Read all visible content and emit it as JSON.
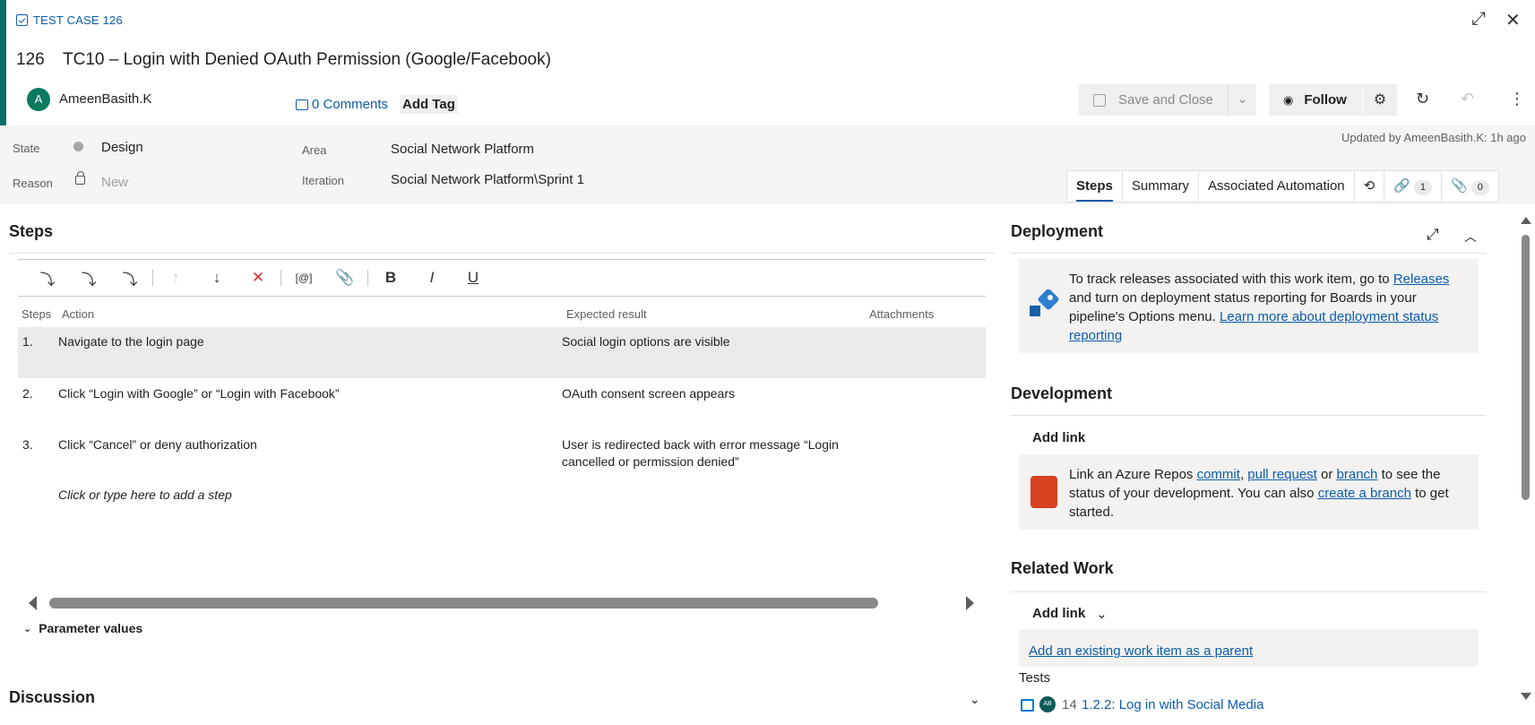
{
  "header": {
    "work_item_type": "TEST CASE 126",
    "id": "126",
    "title": "TC10 – Login with Denied OAuth Permission (Google/Facebook)",
    "owner_initial": "A",
    "owner": "AmeenBasith.K",
    "comments": "0 Comments",
    "add_tag": "Add Tag",
    "save_label": "Save and Close",
    "follow_label": "Follow",
    "updated": "Updated by AmeenBasith.K: 1h ago"
  },
  "fields": {
    "state_label": "State",
    "state_value": "Design",
    "reason_label": "Reason",
    "reason_value": "New",
    "area_label": "Area",
    "area_value": "Social Network Platform",
    "iteration_label": "Iteration",
    "iteration_value": "Social Network Platform\\Sprint 1"
  },
  "tabs": {
    "steps": "Steps",
    "summary": "Summary",
    "automation": "Associated Automation",
    "links_count": "1",
    "attachments_count": "0"
  },
  "steps": {
    "title": "Steps",
    "col_steps": "Steps",
    "col_action": "Action",
    "col_expected": "Expected result",
    "col_attachments": "Attachments",
    "rows": [
      {
        "num": "1.",
        "action": "Navigate to the login page",
        "expected": "Social login options are visible"
      },
      {
        "num": "2.",
        "action": "Click “Login with Google” or “Login with Facebook”",
        "expected": "OAuth consent screen appears"
      },
      {
        "num": "3.",
        "action": "Click “Cancel” or deny authorization",
        "expected": "User is redirected back with error message “Login cancelled or permission denied”"
      }
    ],
    "add_step": "Click or type here to add a step",
    "parameter_values": "Parameter values"
  },
  "discussion": {
    "title": "Discussion"
  },
  "deployment": {
    "title": "Deployment",
    "text_1": "To track releases associated with this work item, go to ",
    "link_releases": "Releases",
    "text_2": " and turn on deployment status reporting for Boards in your pipeline's Options menu. ",
    "link_learn": "Learn more about deployment status reporting"
  },
  "development": {
    "title": "Development",
    "add_link": "Add link",
    "text_1": "Link an Azure Repos ",
    "link_commit": "commit",
    "sep_1": ", ",
    "link_pr": "pull request",
    "sep_2": " or ",
    "link_branch": "branch",
    "text_2": " to see the status of your development. You can also ",
    "link_create": "create a branch",
    "text_3": " to get started."
  },
  "related_work": {
    "title": "Related Work",
    "add_link": "Add link",
    "add_parent": "Add an existing work item as a parent",
    "tests_label": "Tests",
    "test_avatar": "AB",
    "test_id": "14",
    "test_title": "1.2.2: Log in with Social Media"
  },
  "colors": {
    "accent": "#0b6e6a",
    "link": "#0b5cad",
    "delete": "#d13438"
  }
}
